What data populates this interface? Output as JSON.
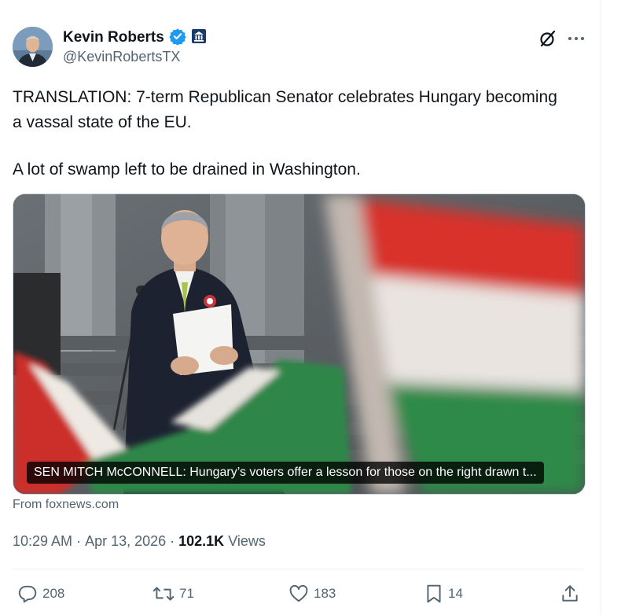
{
  "author": {
    "name": "Kevin Roberts",
    "handle": "@KevinRobertsTX",
    "verified_color": "#1d9bf0"
  },
  "tweet": {
    "paragraphs": [
      "TRANSLATION: 7-term Republican Senator celebrates Hungary becoming a vassal state of the EU.",
      "A lot of swamp left to be drained in Washington."
    ]
  },
  "card": {
    "title": "SEN MITCH McCONNELL: Hungary’s voters offer a lesson for those on the right drawn t...",
    "source": "From foxnews.com"
  },
  "meta": {
    "time": "10:29 AM",
    "sep1": "·",
    "date": "Apr 13, 2026",
    "sep2": "·",
    "views_count": "102.1K",
    "views_label": "Views"
  },
  "actions": {
    "replies": "208",
    "reposts": "71",
    "likes": "183",
    "bookmarks": "14"
  },
  "icons": {
    "verified": "verified-badge-icon",
    "affiliate": "capitol-affiliation-icon",
    "grok": "grok-icon",
    "more": "more-icon",
    "reply": "reply-icon",
    "repost": "repost-icon",
    "like": "heart-icon",
    "bookmark": "bookmark-icon",
    "share": "share-icon"
  }
}
